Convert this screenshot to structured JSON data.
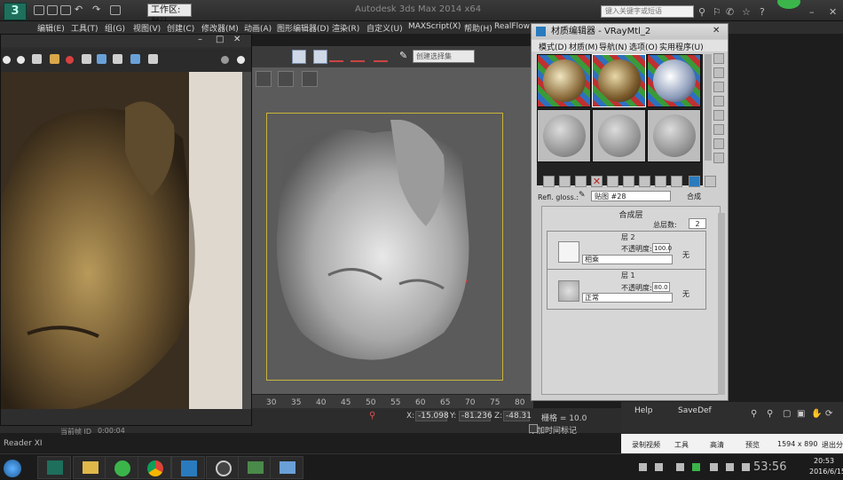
{
  "title_bar": {
    "app_title": "Autodesk 3ds Max 2014 x64",
    "workspace_label": "工作区: 默认",
    "search_placeholder": "键入关键字或短语"
  },
  "menu": {
    "items": [
      "编辑(E)",
      "工具(T)",
      "组(G)",
      "视图(V)",
      "创建(C)",
      "修改器(M)",
      "动画(A)",
      "图形编辑器(D)",
      "渲染(R)",
      "自定义(U)",
      "MAXScript(X)",
      "帮助(H)",
      "RealFlow"
    ]
  },
  "viewport": {
    "selection_set_placeholder": "创建选择集"
  },
  "timeline": {
    "ticks": [
      "30",
      "35",
      "40",
      "45",
      "50",
      "55",
      "60",
      "65",
      "70",
      "75",
      "80"
    ]
  },
  "status": {
    "x_label": "X:",
    "x_value": "-15.098",
    "y_label": "Y:",
    "y_value": "-81.236",
    "z_label": "Z:",
    "z_value": "-48.31",
    "grid": "栅格 = 10.0",
    "add_time_tag": "添加时间标记",
    "frame_text": "当前帧 ID",
    "time_text": "0:00:04"
  },
  "image_window": {
    "taskbar_label": "Reader XI"
  },
  "material_editor": {
    "title": "材质编辑器 - VRayMtl_2",
    "menu": [
      "模式(D)",
      "材质(M)",
      "导航(N)",
      "选项(O)",
      "实用程序(U)"
    ],
    "refl_label": "Refl. gloss.:",
    "map_name": "贴图 #28",
    "map_type": "合成",
    "comp_title": "合成层",
    "total_layers_label": "总层数:",
    "total_layers_value": "2",
    "layers": [
      {
        "title": "层 2",
        "opacity_label": "不透明度:",
        "opacity": "100.0",
        "blend": "相乘",
        "none": "无"
      },
      {
        "title": "层 1",
        "opacity_label": "不透明度:",
        "opacity": "80.0",
        "blend": "正常",
        "none": "无"
      }
    ],
    "help": "Help",
    "savedef": "SaveDef"
  },
  "record_toolbar": {
    "record": "录制视频",
    "tools": "工具",
    "quality": "高清",
    "preview": "预览",
    "resolution": "1594 x 890",
    "exit": "退出分"
  },
  "taskbar": {
    "overlay_time": "53:56",
    "clock_time": "20:53",
    "clock_date": "2016/6/15"
  },
  "colors": {
    "chrome_dark": "#2e2e2e",
    "viewport_bg": "#5b5b5b",
    "frame_yellow": "#c8b43a",
    "panel_light": "#cfcfcf"
  }
}
